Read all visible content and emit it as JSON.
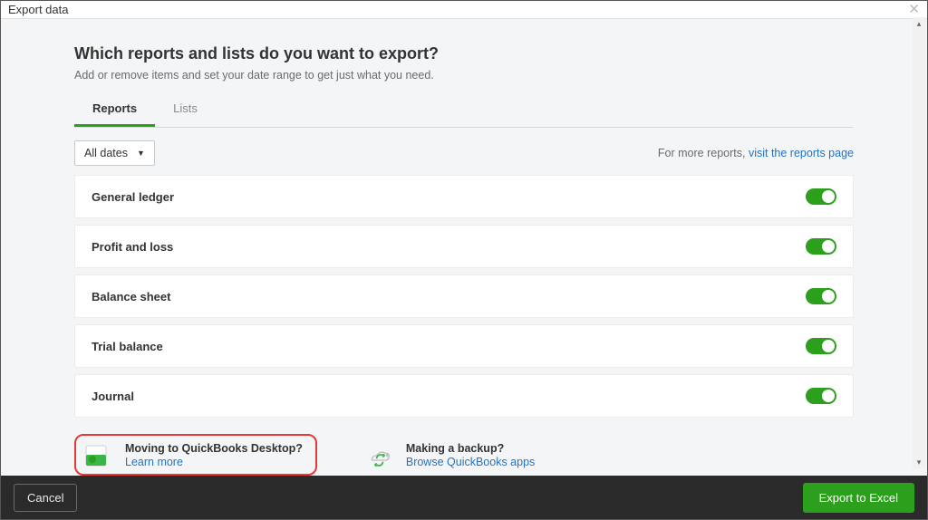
{
  "modal": {
    "title": "Export data",
    "heading": "Which reports and lists do you want to export?",
    "subtext": "Add or remove items and set your date range to get just what you need."
  },
  "tabs": [
    {
      "label": "Reports",
      "active": true
    },
    {
      "label": "Lists",
      "active": false
    }
  ],
  "date_select": {
    "value": "All dates"
  },
  "more_reports": {
    "prefix": "For more reports, ",
    "link": "visit the reports page"
  },
  "reports": [
    {
      "label": "General ledger",
      "enabled": true
    },
    {
      "label": "Profit and loss",
      "enabled": true
    },
    {
      "label": "Balance sheet",
      "enabled": true
    },
    {
      "label": "Trial balance",
      "enabled": true
    },
    {
      "label": "Journal",
      "enabled": true
    }
  ],
  "callouts": {
    "desktop": {
      "title": "Moving to QuickBooks Desktop?",
      "link": "Learn more"
    },
    "backup": {
      "title": "Making a backup?",
      "link": "Browse QuickBooks apps"
    }
  },
  "footer": {
    "cancel": "Cancel",
    "export": "Export to Excel"
  }
}
